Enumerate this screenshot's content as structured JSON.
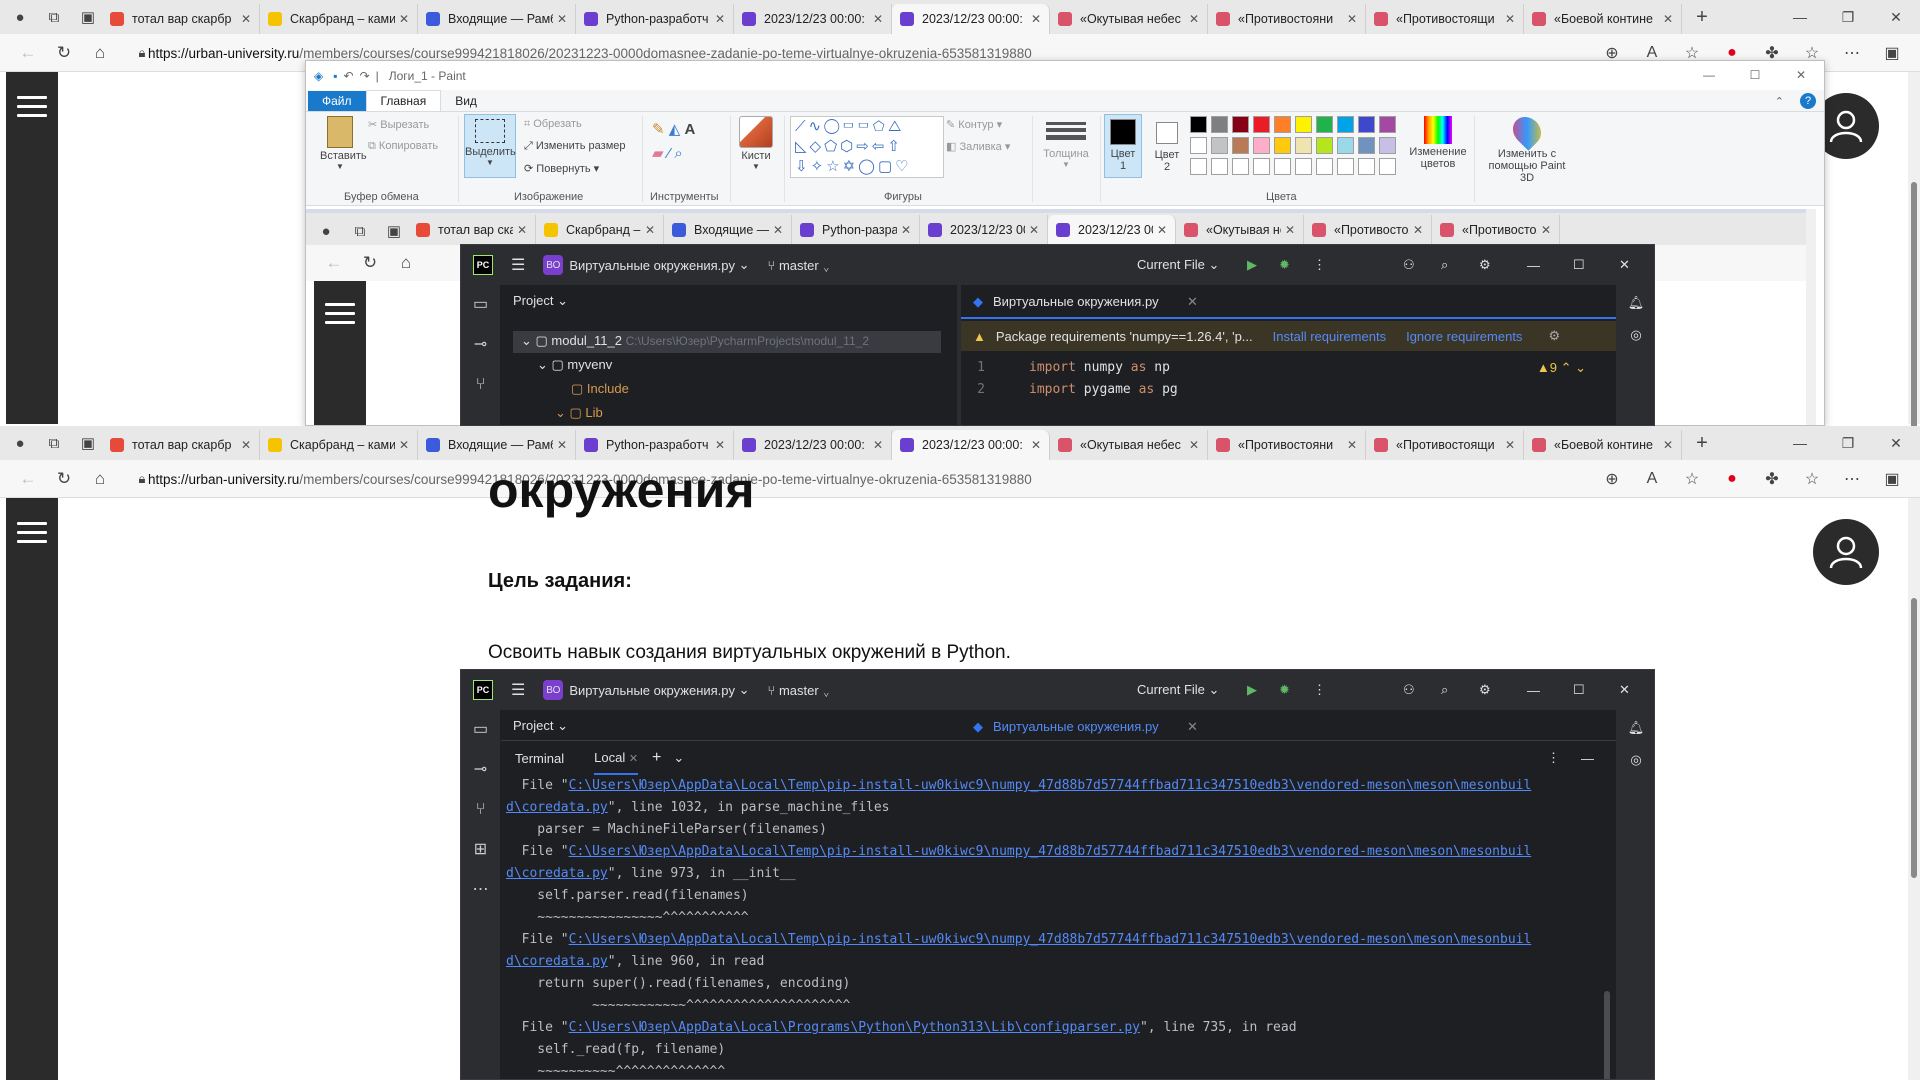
{
  "browser": {
    "tabs": [
      {
        "title": "тотал вар скарбр",
        "fav": "#e84a3a",
        "icon": "yandex-icon"
      },
      {
        "title": "Скарбранд – ками",
        "fav": "#f5c400",
        "icon": "youtube-like-icon"
      },
      {
        "title": "Входящие — Рамб",
        "fav": "#3b5bdb",
        "icon": "mail-icon"
      },
      {
        "title": "Python-разработч",
        "fav": "#6a3fd0",
        "icon": "urban-icon"
      },
      {
        "title": "2023/12/23 00:00:",
        "fav": "#6a3fd0",
        "icon": "urban-icon"
      },
      {
        "title": "2023/12/23 00:00:",
        "fav": "#6a3fd0",
        "icon": "urban-icon",
        "active": true
      },
      {
        "title": "«Окутывая небес",
        "fav": "#d9536b",
        "icon": "book-icon"
      },
      {
        "title": "«Противостояни",
        "fav": "#d9536b",
        "icon": "book-icon"
      },
      {
        "title": "«Противостоящи",
        "fav": "#d9536b",
        "icon": "book-icon"
      },
      {
        "title": "«Боевой контине",
        "fav": "#d9536b",
        "icon": "book-icon"
      }
    ],
    "url_domain": "https://urban-university.ru",
    "url_path": "/members/courses/course999421818026/20231223-0000domasnee-zadanie-po-teme-virtualnye-okruzenia-653581319880"
  },
  "paint": {
    "title": "Логи_1 - Paint",
    "menu": {
      "file": "Файл",
      "home": "Главная",
      "view": "Вид"
    },
    "clipboard": {
      "paste": "Вставить",
      "cut": "Вырезать",
      "copy": "Копировать",
      "label": "Буфер обмена"
    },
    "image": {
      "select": "Выделить",
      "crop": "Обрезать",
      "resize": "Изменить размер",
      "rotate": "Повернуть",
      "label": "Изображение"
    },
    "tools_label": "Инструменты",
    "brushes": "Кисти",
    "shapes": {
      "outline": "Контур",
      "fill": "Заливка",
      "label": "Фигуры"
    },
    "thickness": "Толщина",
    "color1": "Цвет",
    "color1_num": "1",
    "color2": "Цвет",
    "color2_num": "2",
    "colors_label": "Цвета",
    "edit_colors": "Изменение цветов",
    "paint3d": "Изменить с помощью Paint 3D",
    "palette_row1": [
      "#000000",
      "#7f7f7f",
      "#880015",
      "#ed1c24",
      "#ff7f27",
      "#fff200",
      "#22b14c",
      "#00a2e8",
      "#3f48cc",
      "#a349a4"
    ],
    "palette_row2": [
      "#ffffff",
      "#c3c3c3",
      "#b97a57",
      "#ffaec9",
      "#ffc90e",
      "#efe4b0",
      "#b5e61d",
      "#99d9ea",
      "#7092be",
      "#c8bfe7"
    ]
  },
  "pycharm": {
    "project_badge": "ВО",
    "project_name": "Виртуальные окружения.py",
    "branch": "master",
    "run_config": "Current File",
    "project_label": "Project",
    "file_tab": "Виртуальные окружения.py",
    "tree": [
      {
        "name": "modul_11_2",
        "path": "C:\\Users\\Юзер\\PycharmProjects\\modul_11_2"
      },
      {
        "name": "myvenv"
      },
      {
        "name": "Include"
      },
      {
        "name": "Lib"
      }
    ],
    "banner": "Package requirements 'numpy==1.26.4', 'p...",
    "install_req": "Install requirements",
    "ignore_req": "Ignore requirements",
    "code": [
      {
        "n": "1",
        "kw": "import",
        "mod": "numpy",
        "as": "as",
        "alias": "np"
      },
      {
        "n": "2",
        "kw": "import",
        "mod": "pygame",
        "as": "as",
        "alias": "pg"
      }
    ],
    "warnings": "9",
    "terminal_label": "Terminal",
    "local_tab": "Local"
  },
  "page": {
    "heading_partial": "окружения",
    "goal_label": "Цель задания:",
    "goal_text": "Освоить навык создания виртуальных окружений в Python."
  },
  "terminal_lines": [
    {
      "pre": "  File \"",
      "link": "C:\\Users\\Юзер\\AppData\\Local\\Temp\\pip-install-uw0kiwc9\\numpy_47d88b7d57744ffbad711c347510edb3\\vendored-meson\\meson\\mesonbuil",
      "post": ""
    },
    {
      "pre": "",
      "link": "d\\coredata.py",
      "post": "\", line 1032, in parse_machine_files"
    },
    {
      "pre": "    parser = MachineFileParser(filenames)",
      "link": "",
      "post": ""
    },
    {
      "pre": "  File \"",
      "link": "C:\\Users\\Юзер\\AppData\\Local\\Temp\\pip-install-uw0kiwc9\\numpy_47d88b7d57744ffbad711c347510edb3\\vendored-meson\\meson\\mesonbuil",
      "post": ""
    },
    {
      "pre": "",
      "link": "d\\coredata.py",
      "post": "\", line 973, in __init__"
    },
    {
      "pre": "    self.parser.read(filenames)",
      "link": "",
      "post": ""
    },
    {
      "pre": "    ~~~~~~~~~~~~~~~~^^^^^^^^^^^",
      "link": "",
      "post": ""
    },
    {
      "pre": "  File \"",
      "link": "C:\\Users\\Юзер\\AppData\\Local\\Temp\\pip-install-uw0kiwc9\\numpy_47d88b7d57744ffbad711c347510edb3\\vendored-meson\\meson\\mesonbuil",
      "post": ""
    },
    {
      "pre": "",
      "link": "d\\coredata.py",
      "post": "\", line 960, in read"
    },
    {
      "pre": "    return super().read(filenames, encoding)",
      "link": "",
      "post": ""
    },
    {
      "pre": "           ~~~~~~~~~~~~^^^^^^^^^^^^^^^^^^^^^",
      "link": "",
      "post": ""
    },
    {
      "pre": "  File \"",
      "link": "C:\\Users\\Юзер\\AppData\\Local\\Programs\\Python\\Python313\\Lib\\configparser.py",
      "post": "\", line 735, in read"
    },
    {
      "pre": "    self._read(fp, filename)",
      "link": "",
      "post": ""
    },
    {
      "pre": "    ~~~~~~~~~~^^^^^^^^^^^^^^",
      "link": "",
      "post": ""
    }
  ]
}
